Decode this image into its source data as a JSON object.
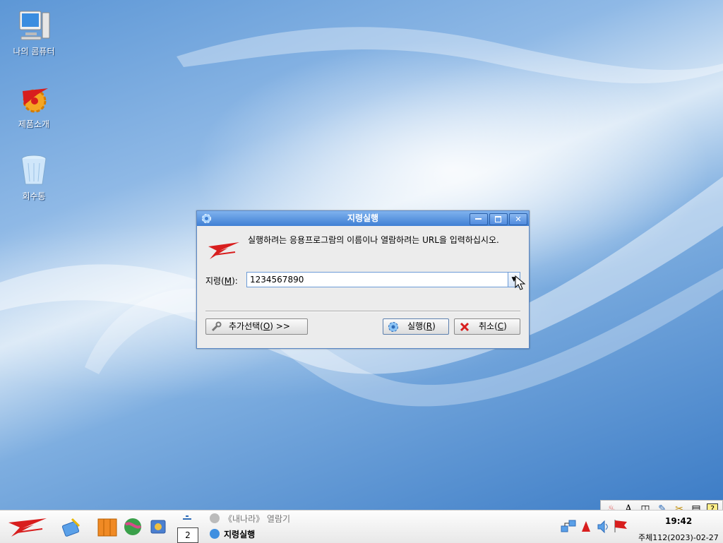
{
  "desktop": {
    "icons": [
      {
        "label": "나의 콤퓨터",
        "icon": "computer-icon"
      },
      {
        "label": "제품소개",
        "icon": "red-star-gear-icon"
      },
      {
        "label": "회수통",
        "icon": "recycle-bin-icon"
      }
    ]
  },
  "dialog": {
    "title": "지령실행",
    "message": "실행하려는 응용프로그람의 이름이나 열람하려는 URL을 입력하십시오.",
    "command_label_prefix": "지령(",
    "command_label_key": "M",
    "command_label_suffix": "):",
    "command_value": "1234567890",
    "more_options_label_prefix": "추가선택(",
    "more_options_key": "O",
    "more_options_label_suffix": ") >>",
    "run_label_prefix": "실행(",
    "run_key": "R",
    "run_label_suffix": ")",
    "cancel_label_prefix": "취소(",
    "cancel_key": "C",
    "cancel_label_suffix": ")"
  },
  "taskbar": {
    "pager_number": "2",
    "tasks": [
      {
        "label": "《내나라》 열람기",
        "active": false
      },
      {
        "label": "지령실행",
        "active": true
      }
    ],
    "clock_time": "19:42",
    "clock_date": "주체112(2023)-02-27"
  },
  "ime_bar": {
    "items": [
      "red-star-icon",
      "A",
      "split-window-icon",
      "edit-icon",
      "tools-icon",
      "keyboard-icon",
      "help-icon"
    ]
  },
  "colors": {
    "accent": "#3f7fd4",
    "brand_red": "#d81e1e"
  }
}
